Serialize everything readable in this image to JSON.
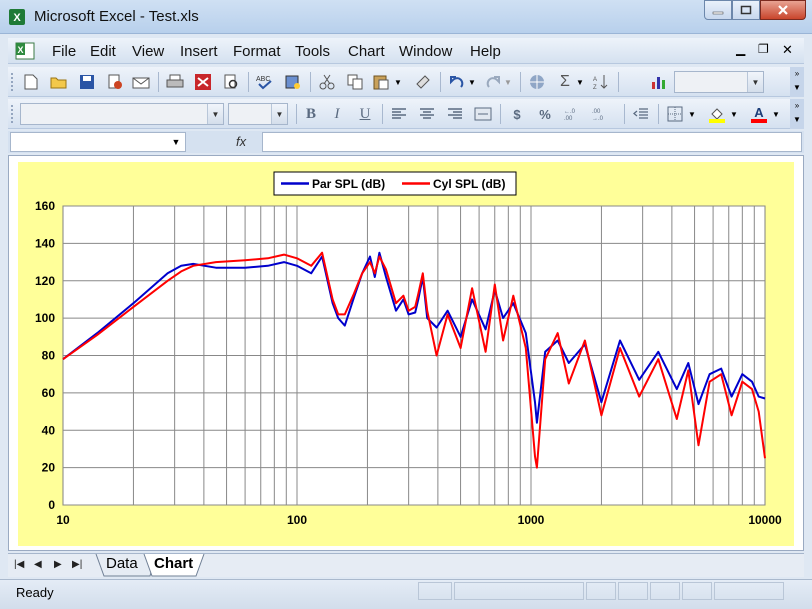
{
  "window": {
    "title": "Microsoft Excel - Test.xls"
  },
  "menu": [
    {
      "label": "File"
    },
    {
      "label": "Edit"
    },
    {
      "label": "View"
    },
    {
      "label": "Insert"
    },
    {
      "label": "Format"
    },
    {
      "label": "Tools"
    },
    {
      "label": "Chart"
    },
    {
      "label": "Window"
    },
    {
      "label": "Help"
    }
  ],
  "formula": {
    "fx_label": "fx"
  },
  "sheets": {
    "tab1": "Data",
    "tab2": "Chart",
    "active": "Chart"
  },
  "status": {
    "text": "Ready"
  },
  "chart_data": {
    "type": "line",
    "title": "",
    "xlabel": "",
    "ylabel": "",
    "x_scale": "log",
    "xlim": [
      10,
      10000
    ],
    "ylim": [
      0,
      160
    ],
    "x_ticks": [
      "10",
      "100",
      "1000",
      "10000"
    ],
    "y_ticks": [
      "0",
      "20",
      "40",
      "60",
      "80",
      "100",
      "120",
      "140",
      "160"
    ],
    "grid": true,
    "legend": "top-center",
    "background": "#ffff99",
    "series": [
      {
        "name": "Par SPL (dB)",
        "color": "#0000cc",
        "x": [
          10,
          14,
          20,
          28,
          32,
          36,
          45,
          60,
          75,
          88,
          100,
          115,
          128,
          142,
          150,
          160,
          175,
          190,
          205,
          215,
          225,
          240,
          265,
          285,
          300,
          320,
          330,
          345,
          360,
          395,
          440,
          500,
          560,
          640,
          700,
          760,
          840,
          950,
          1040,
          1060,
          1150,
          1300,
          1450,
          1700,
          2000,
          2400,
          2900,
          3500,
          4200,
          4700,
          5200,
          5800,
          6500,
          7200,
          8000,
          8800,
          9400,
          10000
        ],
        "y": [
          78,
          92,
          108,
          124,
          128,
          129,
          127,
          127,
          128,
          130,
          128,
          124,
          133,
          108,
          100,
          96,
          111,
          124,
          133,
          122,
          135,
          122,
          104,
          110,
          102,
          103,
          110,
          122,
          100,
          95,
          104,
          90,
          110,
          94,
          115,
          100,
          108,
          92,
          55,
          44,
          82,
          88,
          76,
          86,
          55,
          88,
          67,
          82,
          62,
          76,
          54,
          70,
          73,
          58,
          70,
          66,
          58,
          57
        ]
      },
      {
        "name": "Cyl SPL (dB)",
        "color": "#ff0000",
        "x": [
          10,
          14,
          20,
          28,
          32,
          36,
          45,
          60,
          75,
          88,
          100,
          115,
          128,
          142,
          150,
          160,
          175,
          190,
          205,
          215,
          225,
          240,
          265,
          285,
          300,
          320,
          330,
          345,
          360,
          395,
          440,
          500,
          560,
          640,
          700,
          760,
          840,
          950,
          1040,
          1060,
          1150,
          1300,
          1450,
          1700,
          2000,
          2400,
          2900,
          3500,
          4200,
          4700,
          5200,
          5800,
          6500,
          7200,
          8000,
          8800,
          9400,
          10000
        ],
        "y": [
          78,
          91,
          106,
          120,
          125,
          128,
          130,
          131,
          132,
          134,
          132,
          128,
          135,
          110,
          102,
          102,
          113,
          124,
          130,
          124,
          133,
          126,
          108,
          112,
          104,
          106,
          113,
          124,
          104,
          80,
          102,
          84,
          116,
          82,
          118,
          88,
          112,
          84,
          26,
          20,
          78,
          92,
          65,
          88,
          48,
          84,
          58,
          78,
          46,
          72,
          32,
          66,
          70,
          48,
          66,
          62,
          50,
          25
        ]
      }
    ]
  }
}
